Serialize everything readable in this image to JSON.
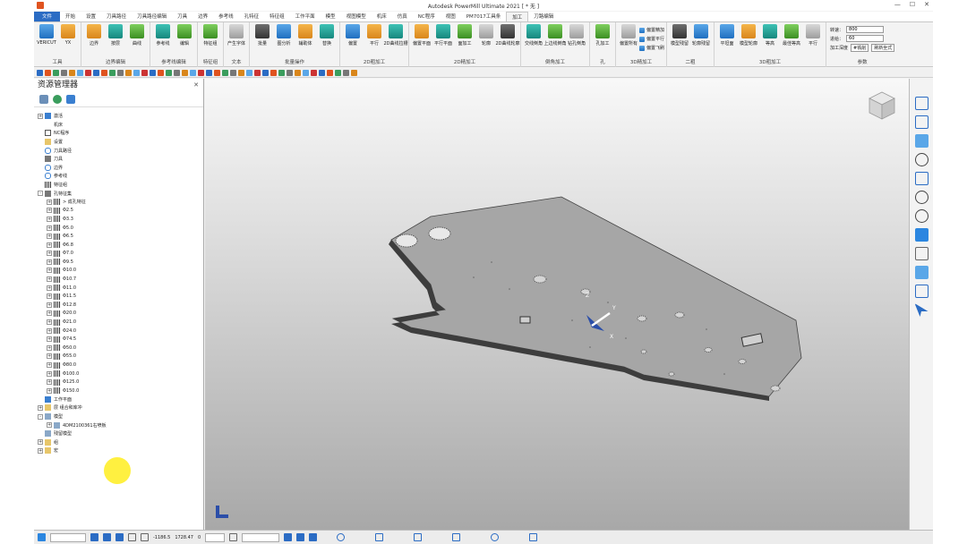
{
  "title_bar": {
    "title": "Autodesk PowerMill Ultimate 2021   [ * 无 ]"
  },
  "menu_tabs": [
    "文件",
    "开始",
    "设置",
    "刀具路径",
    "刀具路径编辑",
    "刀具",
    "边界",
    "参考线",
    "孔特征",
    "特征组",
    "工作平面",
    "模型",
    "视图模型",
    "机床",
    "仿真",
    "NC程序",
    "视图",
    "PM7017工具条",
    "加工",
    "刀路编辑"
  ],
  "ribbon": {
    "groups": [
      {
        "label": "工具",
        "buttons": [
          "VERICUT",
          "YX"
        ]
      },
      {
        "label": "边界编辑",
        "buttons": [
          "边界",
          "按层",
          "曲线"
        ]
      },
      {
        "label": "参考线编辑",
        "buttons": [
          "参考线",
          "编辑"
        ]
      },
      {
        "label": "特征组",
        "buttons": [
          "特征组"
        ]
      },
      {
        "label": "文本",
        "buttons": [
          "产生字体"
        ]
      },
      {
        "label": "批量操作",
        "buttons": [
          "批量",
          "图分析",
          "辅助体",
          "替换"
        ]
      },
      {
        "label": "2D粗加工",
        "buttons": [
          "偏置",
          "平行",
          "2D曲线拉槽"
        ]
      },
      {
        "label": "2D精加工",
        "buttons": [
          "偏置平面",
          "平行平面",
          "面加工",
          "轮廓",
          "2D曲线轮廓"
        ]
      },
      {
        "label": "倒角加工",
        "buttons": [
          "交线倒角",
          "上边线倒角",
          "钻孔倒角"
        ]
      },
      {
        "label": "孔",
        "buttons": [
          "孔加工"
        ]
      },
      {
        "label": "3D精加工",
        "buttons": [
          "偏置所有"
        ],
        "small": [
          "偏置精加",
          "偏置平行",
          "偏置飞刷"
        ]
      },
      {
        "label": "二粗",
        "buttons": [
          "模型残留",
          "轮廓残留"
        ]
      },
      {
        "label": "3D粗加工",
        "buttons": [
          "平坦面",
          "模型轮廓",
          "等高",
          "最佳等高",
          "平行"
        ]
      }
    ],
    "params": {
      "label": "参数",
      "feed_label": "转速：",
      "feed_value": "800",
      "step_label": "进给：",
      "step_value": "60",
      "depth_label": "加工深度",
      "btn1": "#铣削",
      "btn2": "刷新坐式"
    }
  },
  "explorer": {
    "title": "资源管理器",
    "tree": [
      {
        "label": "激活",
        "level": 0,
        "icon": "blue",
        "exp": "+"
      },
      {
        "label": "机床",
        "level": 0,
        "icon": "gray",
        "exp": ""
      },
      {
        "label": "NC程序",
        "level": 0,
        "icon": "ncp",
        "exp": ""
      },
      {
        "label": "设置",
        "level": 0,
        "icon": "folder",
        "exp": ""
      },
      {
        "label": "刀具路径",
        "level": 0,
        "icon": "curve",
        "exp": ""
      },
      {
        "label": "刀具",
        "level": 0,
        "icon": "tool",
        "exp": ""
      },
      {
        "label": "边界",
        "level": 0,
        "icon": "curve",
        "exp": ""
      },
      {
        "label": "参考线",
        "level": 0,
        "icon": "curve",
        "exp": ""
      },
      {
        "label": "特征组",
        "level": 0,
        "icon": "dots",
        "exp": ""
      },
      {
        "label": "孔特征集",
        "level": 0,
        "icon": "tool",
        "exp": "-"
      },
      {
        "label": "> 成孔特征",
        "level": 1,
        "icon": "dots",
        "exp": "+"
      },
      {
        "label": "Φ2.5",
        "level": 1,
        "icon": "dots",
        "exp": "+"
      },
      {
        "label": "Φ3.3",
        "level": 1,
        "icon": "dots",
        "exp": "+"
      },
      {
        "label": "Φ5.0",
        "level": 1,
        "icon": "dots",
        "exp": "+"
      },
      {
        "label": "Φ6.5",
        "level": 1,
        "icon": "dots",
        "exp": "+"
      },
      {
        "label": "Φ6.8",
        "level": 1,
        "icon": "dots",
        "exp": "+"
      },
      {
        "label": "Φ7.0",
        "level": 1,
        "icon": "dots",
        "exp": "+"
      },
      {
        "label": "Φ9.5",
        "level": 1,
        "icon": "dots",
        "exp": "+"
      },
      {
        "label": "Φ10.0",
        "level": 1,
        "icon": "dots",
        "exp": "+"
      },
      {
        "label": "Φ10.7",
        "level": 1,
        "icon": "dots",
        "exp": "+"
      },
      {
        "label": "Φ11.0",
        "level": 1,
        "icon": "dots",
        "exp": "+"
      },
      {
        "label": "Φ11.5",
        "level": 1,
        "icon": "dots",
        "exp": "+"
      },
      {
        "label": "Φ12.8",
        "level": 1,
        "icon": "dots",
        "exp": "+"
      },
      {
        "label": "Φ20.0",
        "level": 1,
        "icon": "dots",
        "exp": "+"
      },
      {
        "label": "Φ21.0",
        "level": 1,
        "icon": "dots",
        "exp": "+"
      },
      {
        "label": "Φ24.0",
        "level": 1,
        "icon": "dots",
        "exp": "+"
      },
      {
        "label": "Φ74.5",
        "level": 1,
        "icon": "dots",
        "exp": "+"
      },
      {
        "label": "Φ50.0",
        "level": 1,
        "icon": "dots",
        "exp": "+"
      },
      {
        "label": "Φ55.0",
        "level": 1,
        "icon": "dots",
        "exp": "+"
      },
      {
        "label": "Φ80.0",
        "level": 1,
        "icon": "dots",
        "exp": "+"
      },
      {
        "label": "Φ100.0",
        "level": 1,
        "icon": "dots",
        "exp": "+"
      },
      {
        "label": "Φ125.0",
        "level": 1,
        "icon": "dots",
        "exp": "+"
      },
      {
        "label": "Φ150.0",
        "level": 1,
        "icon": "dots",
        "exp": "+"
      },
      {
        "label": "工作平面",
        "level": 0,
        "icon": "blue",
        "exp": ""
      },
      {
        "label": "层 组合和库冲",
        "level": 0,
        "icon": "folder",
        "exp": "+"
      },
      {
        "label": "模型",
        "level": 0,
        "icon": "model",
        "exp": "-"
      },
      {
        "label": "4DM2100361右喷板",
        "level": 1,
        "icon": "model",
        "exp": "+"
      },
      {
        "label": "残留模型",
        "level": 0,
        "icon": "model",
        "exp": ""
      },
      {
        "label": "组",
        "level": 0,
        "icon": "folder",
        "exp": "+"
      },
      {
        "label": "宏",
        "level": 0,
        "icon": "folder",
        "exp": "+"
      }
    ]
  },
  "status": {
    "coord_x": "-1186.5",
    "coord_y": "1728.47",
    "coord_z": "0"
  },
  "colors": {
    "file_tab": "#2b6cc4",
    "highlight": "#ffeb00",
    "axis_blue": "#2b4ea8"
  }
}
